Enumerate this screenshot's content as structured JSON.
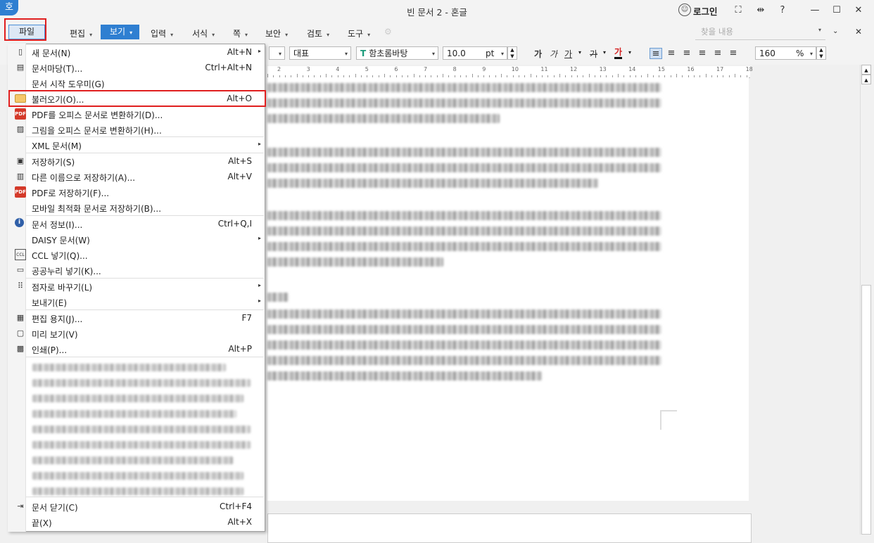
{
  "window": {
    "title": "빈 문서 2 - 혼글",
    "app_logo": "호",
    "login": "로그인"
  },
  "menubar": {
    "items": [
      "파일",
      "편집",
      "보기",
      "입력",
      "서식",
      "쪽",
      "보안",
      "검토",
      "도구"
    ],
    "find_placeholder": "찾을 내용"
  },
  "toolbar": {
    "style_value": "대표",
    "font_value": "함초롬바탕",
    "font_icon": "T",
    "size_value": "10.0",
    "size_unit": "pt",
    "bold": "가",
    "italic": "가",
    "underline": "가",
    "strike": "가",
    "color": "가",
    "zoom_value": "160",
    "zoom_unit": "%"
  },
  "ruler": {
    "ticks": [
      "2",
      "3",
      "4",
      "5",
      "6",
      "7",
      "8",
      "9",
      "10",
      "11",
      "12",
      "13",
      "14",
      "15",
      "16",
      "17",
      "18"
    ]
  },
  "file_menu": {
    "items": [
      {
        "icon": "new-doc-icon",
        "label": "새 문서(N)",
        "shortcut": "Alt+N",
        "submenu": true
      },
      {
        "icon": "doc-madang-icon",
        "label": "문서마당(T)...",
        "shortcut": "Ctrl+Alt+N",
        "submenu": false
      },
      {
        "icon": "",
        "label": "문서 시작 도우미(G)",
        "shortcut": "",
        "submenu": false
      },
      {
        "icon": "folder-open-icon",
        "label": "불러오기(O)...",
        "shortcut": "Alt+O",
        "submenu": false
      },
      {
        "icon": "pdf-convert-icon",
        "label": "PDF를 오피스 문서로 변환하기(D)...",
        "shortcut": "",
        "submenu": false
      },
      {
        "icon": "image-convert-icon",
        "label": "그림을 오피스 문서로 변환하기(H)...",
        "shortcut": "",
        "submenu": false
      },
      {
        "icon": "",
        "label": "XML 문서(M)",
        "shortcut": "",
        "submenu": true
      },
      {
        "icon": "save-icon",
        "label": "저장하기(S)",
        "shortcut": "Alt+S",
        "submenu": false
      },
      {
        "icon": "save-as-icon",
        "label": "다른 이름으로 저장하기(A)...",
        "shortcut": "Alt+V",
        "submenu": false
      },
      {
        "icon": "pdf-save-icon",
        "label": "PDF로 저장하기(F)...",
        "shortcut": "",
        "submenu": false
      },
      {
        "icon": "",
        "label": "모바일 최적화 문서로 저장하기(B)...",
        "shortcut": "",
        "submenu": false
      },
      {
        "icon": "info-icon",
        "label": "문서 정보(I)...",
        "shortcut": "Ctrl+Q,I",
        "submenu": false
      },
      {
        "icon": "",
        "label": "DAISY 문서(W)",
        "shortcut": "",
        "submenu": true
      },
      {
        "icon": "ccl-icon",
        "label": "CCL 넣기(Q)...",
        "shortcut": "",
        "submenu": false
      },
      {
        "icon": "open-license-icon",
        "label": "공공누리 넣기(K)...",
        "shortcut": "",
        "submenu": false
      },
      {
        "icon": "braille-icon",
        "label": "점자로 바꾸기(L)",
        "shortcut": "",
        "submenu": true
      },
      {
        "icon": "",
        "label": "보내기(E)",
        "shortcut": "",
        "submenu": true
      },
      {
        "icon": "page-setup-icon",
        "label": "편집 용지(J)...",
        "shortcut": "F7",
        "submenu": false
      },
      {
        "icon": "preview-icon",
        "label": "미리 보기(V)",
        "shortcut": "",
        "submenu": false
      },
      {
        "icon": "print-icon",
        "label": "인쇄(P)...",
        "shortcut": "Alt+P",
        "submenu": false
      },
      {
        "icon": "close-doc-icon",
        "label": "문서 닫기(C)",
        "shortcut": "Ctrl+F4",
        "submenu": false
      },
      {
        "icon": "",
        "label": "끝(X)",
        "shortcut": "Alt+X",
        "submenu": false
      }
    ],
    "icon_glyphs": {
      "ccl": "CCL",
      "info": "i",
      "pdf": "PDF"
    }
  }
}
